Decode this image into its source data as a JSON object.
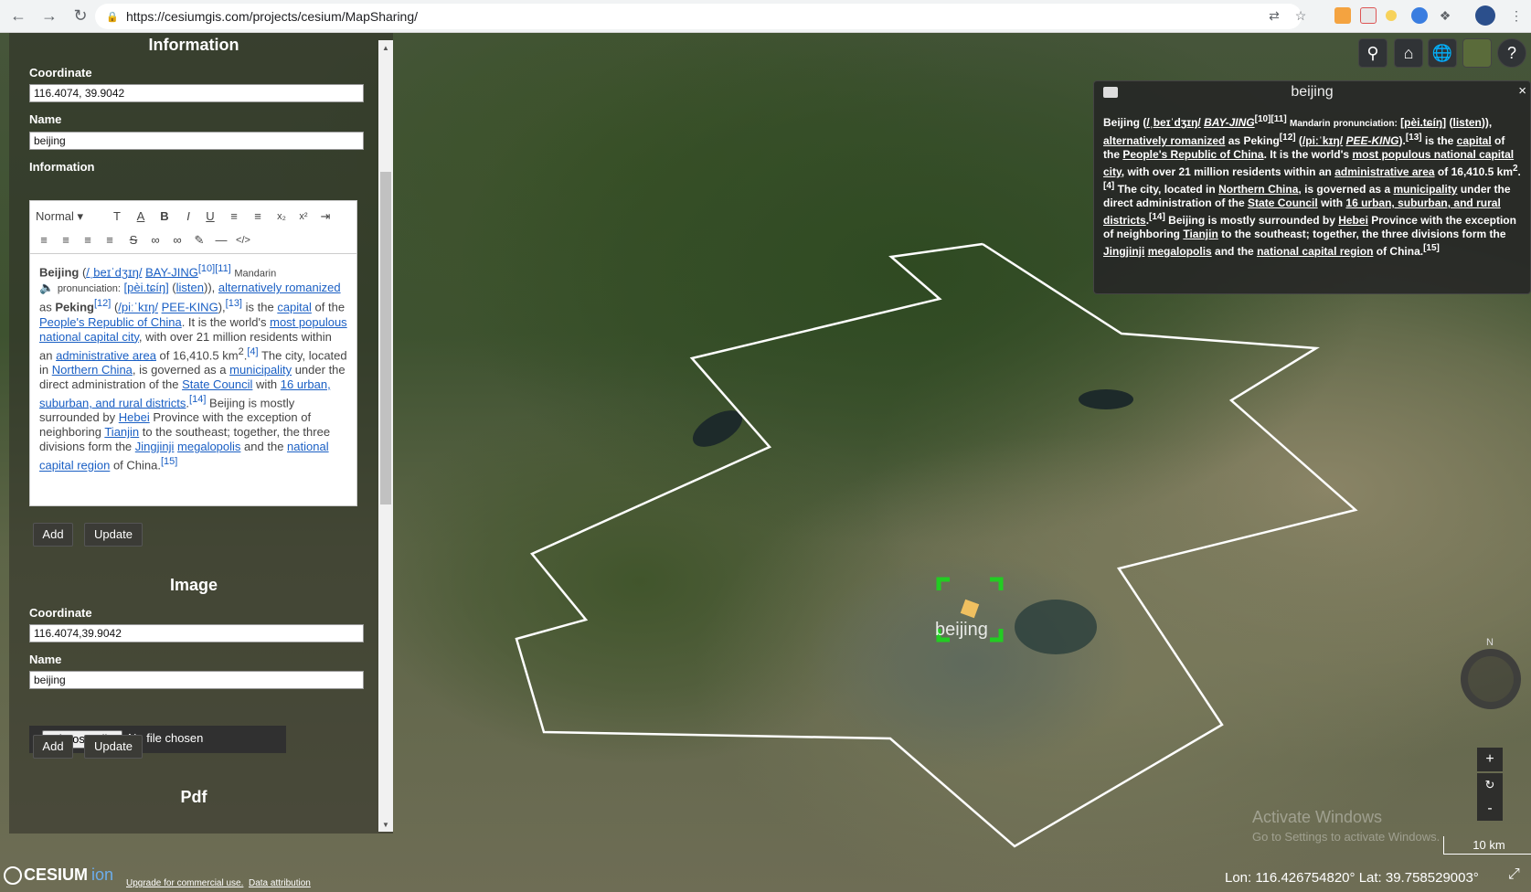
{
  "browser": {
    "url": "https://cesiumgis.com/projects/cesium/MapSharing/"
  },
  "left_panel": {
    "info_section_title": "Information",
    "coordinate_label": "Coordinate",
    "coordinate_value": "116.4074, 39.9042",
    "name_label": "Name",
    "name_value": "beijing",
    "information_label": "Information",
    "editor_toolbar": {
      "format_select": "Normal"
    },
    "add_label": "Add",
    "update_label": "Update",
    "image_section_title": "Image",
    "image_coordinate_label": "Coordinate",
    "image_coordinate_value": "116.4074,39.9042",
    "image_name_label": "Name",
    "image_name_value": "beijing",
    "choose_file_label": "Choose File",
    "no_file_text": "No file chosen",
    "image_add_label": "Add",
    "image_update_label": "Update",
    "pdf_section_title": "Pdf"
  },
  "editor_content": {
    "beijing": "Beijing",
    "pron1": "/ˌbeɪˈdʒɪŋ/",
    "bayjing": "BAY-JING",
    "ref1": "[10][11]",
    "mandarin": "Mandarin",
    "pronunciation": "pronunciation:",
    "pinyin": "[pèi.tɕíŋ]",
    "listen": "listen",
    "alt_rom": "alternatively romanized",
    "as": "as",
    "peking": "Peking",
    "ref2": "[12]",
    "pron2": "/piːˈkɪŋ/",
    "peeking": "PEE-KING",
    "ref3": "[13]",
    "is_the": "is the",
    "capital": "capital",
    "of_the": "of the",
    "prc": "People's Republic of China",
    "worlds": ". It is the world's",
    "most_pop": "most populous national capital city",
    "with_over": ", with over 21 million residents within an",
    "admin_area": "administrative area",
    "of": "of",
    "area_val": "16,410.5 km",
    "sq": "2",
    "ref4": "[4]",
    "city_located": "The city, located in",
    "northern_china": "Northern China",
    "governed": ", is governed as a",
    "municipality": "municipality",
    "under": "under the direct administration of the",
    "state_council": "State Council",
    "with": "with",
    "districts": "16 urban, suburban, and rural districts",
    "ref5": "[14]",
    "surrounded": "Beijing is mostly surrounded by",
    "hebei": "Hebei",
    "province": "Province with the exception of neighboring",
    "tianjin": "Tianjin",
    "southeast": "to the southeast; together, the three divisions form the",
    "jingjinji": "Jingjinji",
    "megalopolis": "megalopolis",
    "and_the": "and the",
    "ncr": "national capital region",
    "of_china": "of China.",
    "ref6": "[15]"
  },
  "info_box": {
    "title": "beijing",
    "close": "×"
  },
  "map": {
    "marker_label": "beijing",
    "compass_n": "N",
    "zoom_in": "+",
    "zoom_reset": "↻",
    "zoom_out": "-",
    "scale": "10 km",
    "coord_readout": "Lon: 116.426754820° Lat: 39.758529003°",
    "watermark_title": "Activate Windows",
    "watermark_sub": "Go to Settings to activate Windows.",
    "logo_text": "CESIUM",
    "logo_ion": "ion",
    "upgrade_link": "Upgrade for commercial use.",
    "data_attribution": "Data attribution"
  },
  "colors": {
    "accent_link": "#1a5fc4",
    "marker_green": "#22cc22",
    "boundary": "#ffffff"
  }
}
